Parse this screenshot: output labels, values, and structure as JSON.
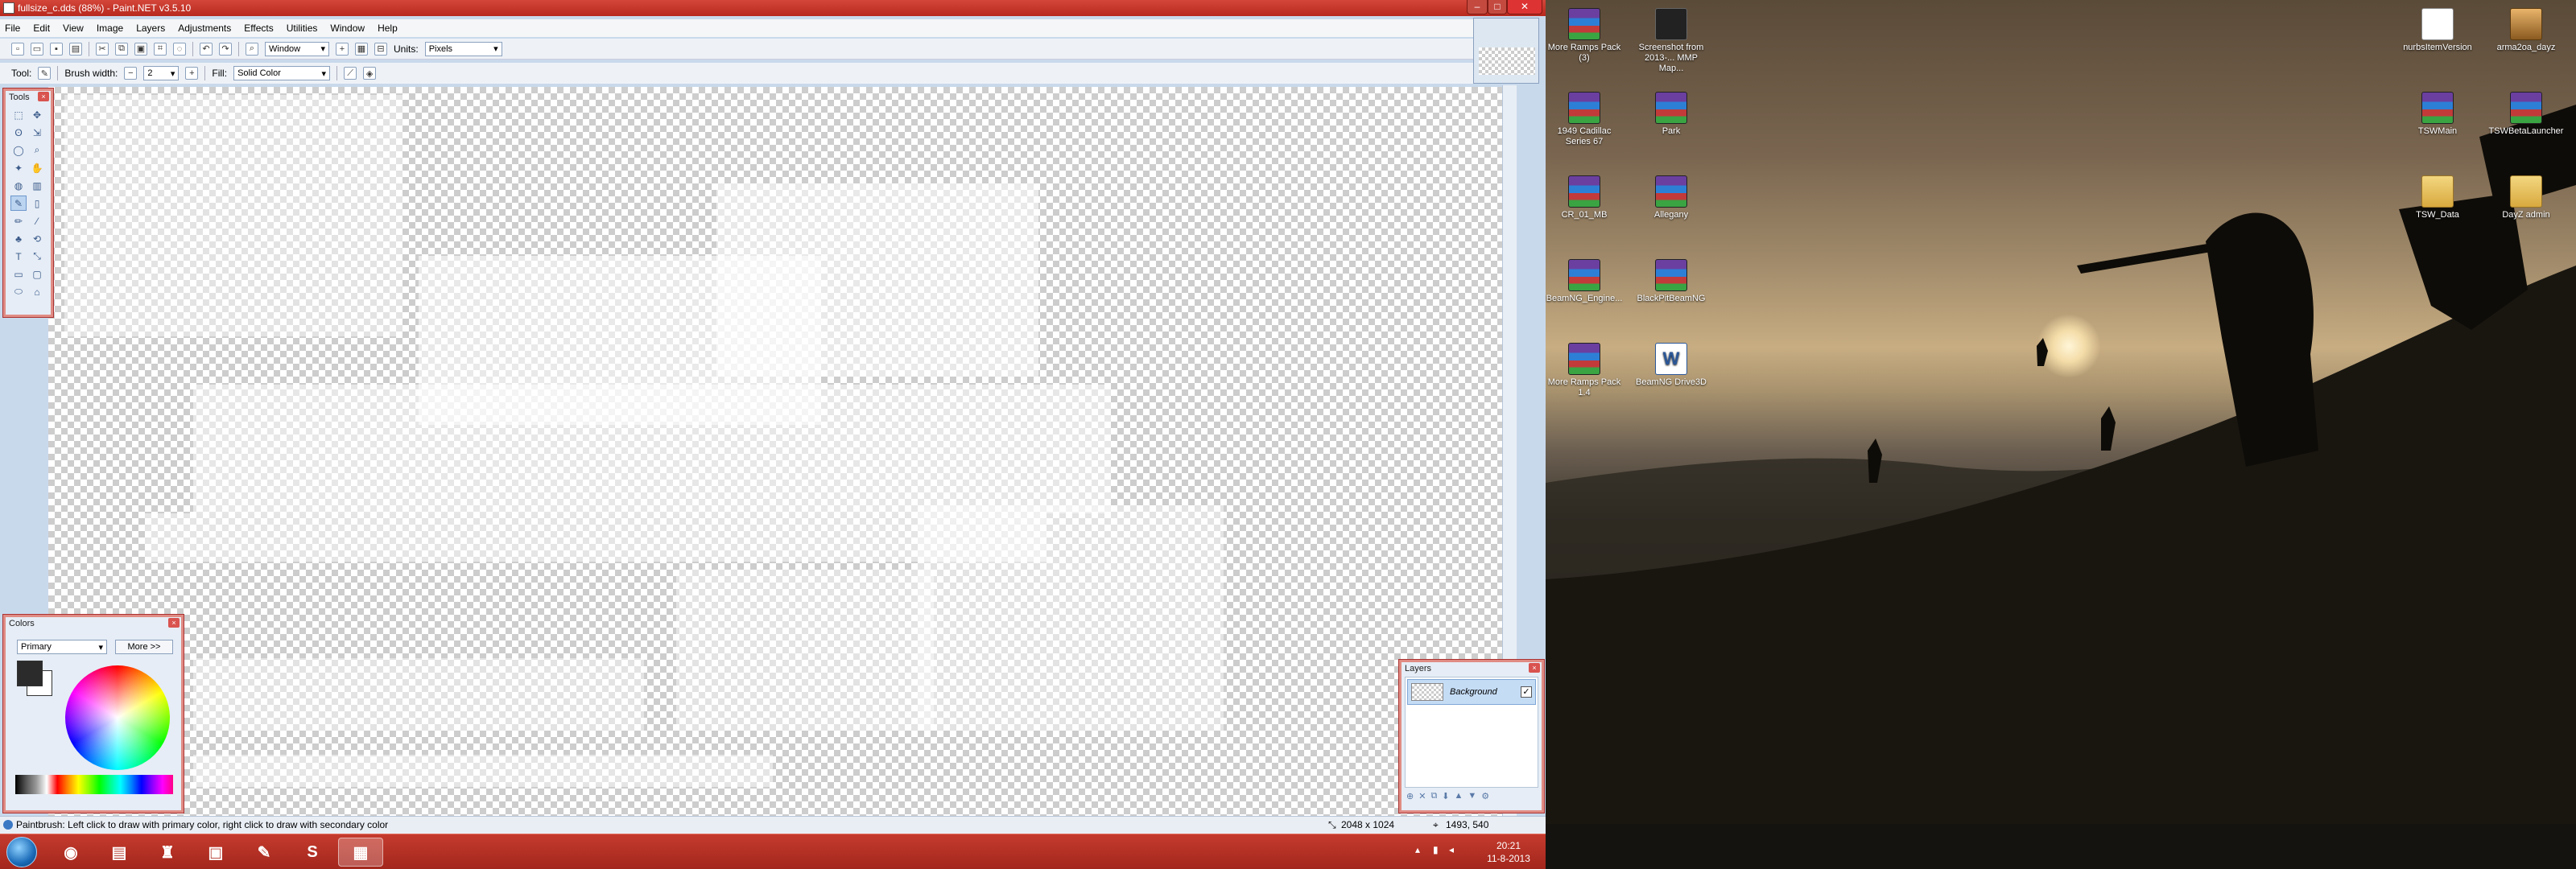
{
  "window": {
    "title": "fullsize_c.dds (88%) - Paint.NET v3.5.10",
    "minimize": "–",
    "maximize": "□",
    "close": "✕"
  },
  "menu": [
    "File",
    "Edit",
    "View",
    "Image",
    "Layers",
    "Adjustments",
    "Effects",
    "Utilities",
    "Window",
    "Help"
  ],
  "toolbar": {
    "zoom_value": "Window",
    "units_label": "Units:",
    "units_value": "Pixels",
    "tool_label": "Tool:",
    "brush_width_label": "Brush width:",
    "brush_width_value": "2",
    "fill_label": "Fill:",
    "fill_value": "Solid Color"
  },
  "tools_palette": {
    "title": "Tools"
  },
  "colors_palette": {
    "title": "Colors",
    "mode_value": "Primary",
    "more_button": "More >>",
    "primary_color": "#2b2b2b",
    "secondary_color": "#ffffff"
  },
  "layers_palette": {
    "title": "Layers",
    "layer_name": "Background",
    "layer_visible": true
  },
  "status": {
    "hint": "Paintbrush: Left click to draw with primary color, right click to draw with secondary color",
    "image_size": "2048 x 1024",
    "cursor_pos": "1493, 540"
  },
  "taskbar": {
    "time": "20:21",
    "date": "11-8-2013",
    "skype_glyph": "S"
  },
  "desktop_icons": [
    {
      "label": "More Ramps Pack (3)",
      "type": "rar"
    },
    {
      "label": "Screenshot from 2013-... MMP Map...",
      "type": "shot"
    },
    {
      "label": "1949 Cadillac Series 67",
      "type": "rar"
    },
    {
      "label": "Park",
      "type": "rar"
    },
    {
      "label": "CR_01_MB",
      "type": "rar"
    },
    {
      "label": "Allegany",
      "type": "rar"
    },
    {
      "label": "BeamNG_Engine...",
      "type": "rar"
    },
    {
      "label": "BlackPitBeamNG",
      "type": "rar"
    },
    {
      "label": "More Ramps Pack 1.4",
      "type": "rar"
    },
    {
      "label": "BeamNG Drive3D",
      "type": "word"
    },
    {
      "label": "nurbsItemVersion",
      "type": "doc"
    },
    {
      "label": "arma2oa_dayz",
      "type": "exe"
    },
    {
      "label": "TSWMain",
      "type": "rar"
    },
    {
      "label": "TSWBetaLauncher",
      "type": "rar"
    },
    {
      "label": "TSW_Data",
      "type": "folder"
    },
    {
      "label": "DayZ admin",
      "type": "folder"
    }
  ]
}
